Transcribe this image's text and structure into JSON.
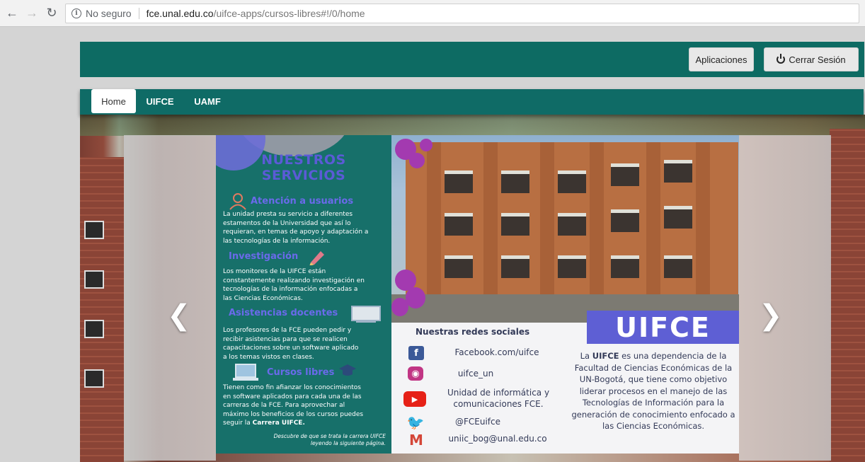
{
  "browser": {
    "security_label": "No seguro",
    "url_host": "fce.unal.edu.co",
    "url_path": "/uifce-apps/cursos-libres#!/0/home"
  },
  "header": {
    "apps_button": "Aplicaciones",
    "logout_button": "Cerrar Sesión",
    "background_color": "#0d6b63"
  },
  "nav": {
    "tabs": [
      {
        "label": "Home",
        "active": true
      },
      {
        "label": "UIFCE",
        "active": false
      },
      {
        "label": "UAMF",
        "active": false
      }
    ]
  },
  "slide": {
    "services_title_line1": "NUESTROS",
    "services_title_line2": "SERVICIOS",
    "services": [
      {
        "heading": "Atención a usuarios",
        "icon": "user-icon",
        "lines": [
          "La unidad presta su servicio a diferentes",
          "estamentos de la Universidad que así lo",
          "requieran, en temas de apoyo y adaptación a",
          "las tecnologías de la información."
        ]
      },
      {
        "heading": "Investigación",
        "icon": "pencil-icon",
        "lines": [
          "Los monitores de la UIFCE están",
          "constantemente realizando investigación en",
          "tecnologías de la información enfocadas a",
          "las Ciencias Económicas."
        ]
      },
      {
        "heading": "Asistencias docentes",
        "icon": "whiteboard-icon",
        "lines": [
          "Los profesores de la FCE pueden pedir y",
          "recibir asistencias para que se realicen",
          "capacitaciones sobre un software aplicado",
          "a los temas vistos en clases."
        ]
      },
      {
        "heading": "Cursos libres",
        "icon": "laptop-icon",
        "lines": [
          "Tienen como fin afianzar los conocimientos",
          "en software aplicados para cada una de las",
          "carreras de la FCE.  Para aprovechar  al",
          "máximo los beneficios de los cursos puedes",
          "seguir la "
        ],
        "bold_tail": "Carrera UIFCE."
      }
    ],
    "footer_line1": "Descubre de que se trata la carrera UIFCE",
    "footer_line2": "leyendo la siguiente página.",
    "logo_text": "UIFCE",
    "social_title": "Nuestras redes sociales",
    "social": [
      {
        "icon": "facebook-icon",
        "text": "Facebook.com/uifce",
        "color": "#3b5998"
      },
      {
        "icon": "instagram-icon",
        "text": "uifce_un",
        "color": "#c13584"
      },
      {
        "icon": "youtube-icon",
        "text_line1": "Unidad de informática y",
        "text_line2": "comunicaciones FCE.",
        "color": "#e62117"
      },
      {
        "icon": "twitter-icon",
        "text": "@FCEuifce",
        "color": "#1da1f2"
      },
      {
        "icon": "gmail-icon",
        "text": "uniic_bog@unal.edu.co",
        "color": "#d44638"
      }
    ],
    "description_bold": "UIFCE",
    "description_prefix": "La ",
    "description_rest": " es una dependencia de la Facultad de Ciencias Económicas de la UN-Bogotá, que tiene como objetivo liderar procesos en el manejo de las Tecnologías de Información para la generación de conocimiento enfocado a las Ciencias Económicas."
  },
  "carousel": {
    "prev_icon": "chevron-left-icon",
    "next_icon": "chevron-right-icon"
  }
}
